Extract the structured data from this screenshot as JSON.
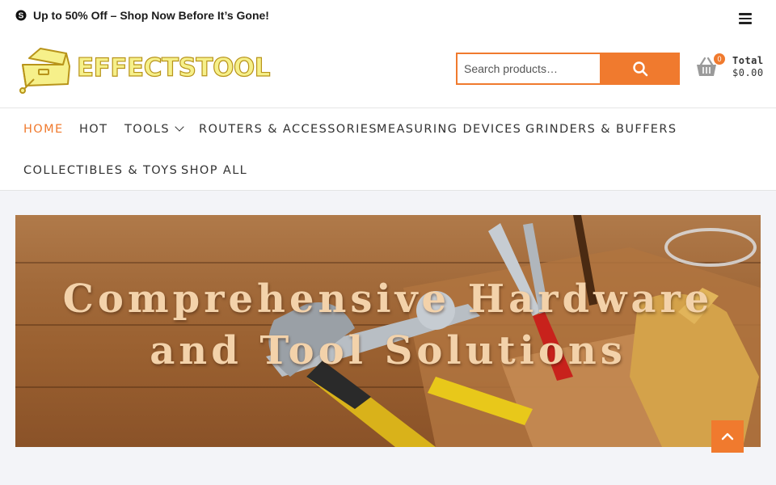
{
  "topbar": {
    "promo_icon": "skype-icon",
    "promo_text": "Up to 50% Off – Shop Now Before It’s Gone!",
    "menu_icon": "hamburger-menu-icon"
  },
  "header": {
    "logo_text": "EFFECTSTOOL",
    "search": {
      "placeholder": "Search products…",
      "button_icon": "search-icon"
    },
    "cart": {
      "count": "0",
      "total_label": "Total",
      "total_value": "$0.00",
      "icon": "basket-icon"
    }
  },
  "nav": {
    "items": [
      {
        "label": "HOME",
        "active": true
      },
      {
        "label": "HOT"
      },
      {
        "label": "TOOLS",
        "has_dropdown": true
      },
      {
        "label": "ROUTERS & ACCESSORIES"
      },
      {
        "label": "MEASURING DEVICES"
      },
      {
        "label": "GRINDERS & BUFFERS"
      },
      {
        "label": "COLLECTIBLES & TOYS"
      },
      {
        "label": "SHOP ALL"
      }
    ]
  },
  "hero": {
    "title_line1": "Comprehensive Hardware",
    "title_line2": "and Tool Solutions"
  },
  "scroll_top": {
    "icon": "chevron-up-icon"
  },
  "colors": {
    "accent": "#f07a2e",
    "background": "#f3f4f8"
  }
}
